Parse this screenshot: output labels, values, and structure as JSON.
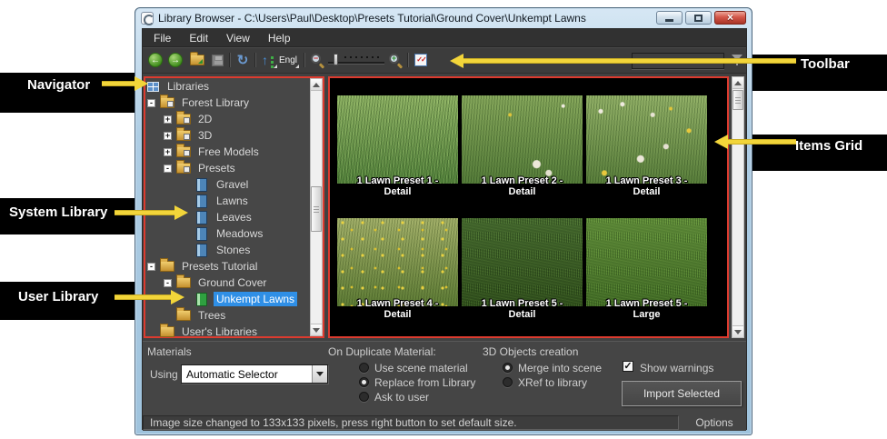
{
  "annotations": {
    "navigator": "Navigator",
    "system_library": "System Library",
    "user_library": "User Library",
    "toolbar": "Toolbar",
    "items_grid": "Items Grid"
  },
  "title_bar": {
    "title": "Library Browser - C:\\Users\\Paul\\Desktop\\Presets Tutorial\\Ground Cover\\Unkempt Lawns"
  },
  "menu": [
    {
      "label": "File"
    },
    {
      "label": "Edit"
    },
    {
      "label": "View"
    },
    {
      "label": "Help"
    }
  ],
  "toolbar": {
    "language_button": "Engl",
    "search_value": ""
  },
  "tree": {
    "items": [
      {
        "label": "Libraries"
      },
      {
        "label": "Forest Library"
      },
      {
        "label": "2D"
      },
      {
        "label": "3D"
      },
      {
        "label": "Free Models"
      },
      {
        "label": "Presets"
      },
      {
        "label": "Gravel"
      },
      {
        "label": "Lawns"
      },
      {
        "label": "Leaves"
      },
      {
        "label": "Meadows"
      },
      {
        "label": "Stones"
      },
      {
        "label": "Presets Tutorial"
      },
      {
        "label": "Ground Cover"
      },
      {
        "label": "Unkempt Lawns",
        "selected": true
      },
      {
        "label": "Trees"
      },
      {
        "label": "User's Libraries"
      }
    ]
  },
  "grid": {
    "items": [
      {
        "title": "1 Lawn Preset 1 -",
        "subtitle": "Detail"
      },
      {
        "title": "1 Lawn Preset 2 -",
        "subtitle": "Detail"
      },
      {
        "title": "1 Lawn Preset 3 -",
        "subtitle": "Detail"
      },
      {
        "title": "1 Lawn Preset 4 -",
        "subtitle": "Detail"
      },
      {
        "title": "1 Lawn Preset 5 -",
        "subtitle": "Detail"
      },
      {
        "title": "1 Lawn Preset 5 -",
        "subtitle": "Large"
      }
    ]
  },
  "options_panel": {
    "materials_label": "Materials",
    "using_label": "Using",
    "material_selector_value": "Automatic Selector",
    "duplicate_group_label": "On Duplicate Material:",
    "duplicate_options": [
      {
        "label": "Use scene material",
        "selected": false
      },
      {
        "label": "Replace from Library",
        "selected": true
      },
      {
        "label": "Ask to user",
        "selected": false
      }
    ],
    "objects_group_label": "3D Objects creation",
    "objects_options": [
      {
        "label": "Merge into scene",
        "selected": true
      },
      {
        "label": "XRef to library",
        "selected": false
      }
    ],
    "show_warnings_label": "Show warnings",
    "show_warnings_checked": true,
    "import_button": "Import Selected"
  },
  "status_bar": {
    "message": "Image size changed to 133x133 pixels, press right button to set default size.",
    "options_label": "Options"
  },
  "colors": {
    "selection_blue": "#2f8fe6",
    "annotation_red": "#dd3b2f",
    "arrow_yellow": "#f2d53a"
  }
}
